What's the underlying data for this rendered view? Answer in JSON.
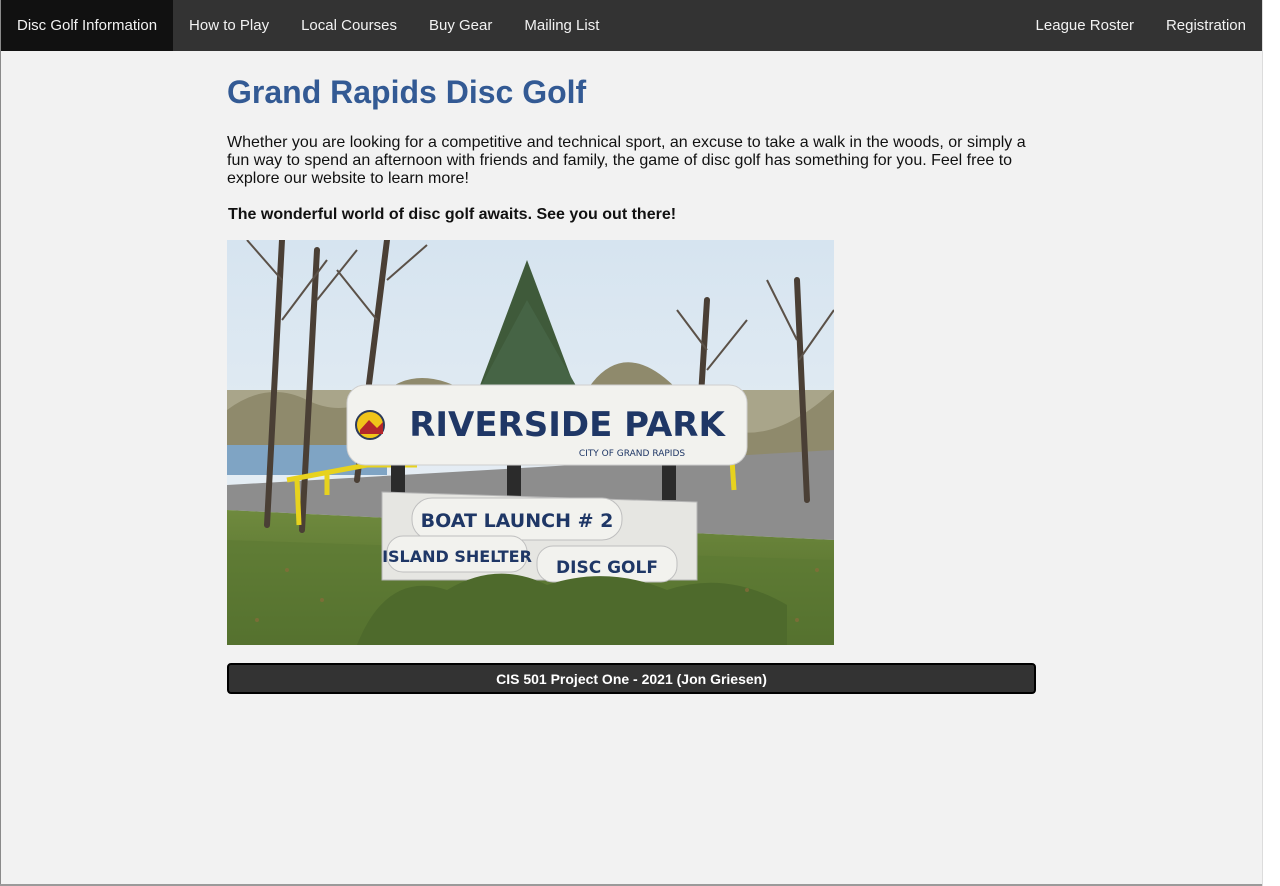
{
  "nav": {
    "left": [
      {
        "label": "Disc Golf Information",
        "active": true
      },
      {
        "label": "How to Play",
        "active": false
      },
      {
        "label": "Local Courses",
        "active": false
      },
      {
        "label": "Buy Gear",
        "active": false
      },
      {
        "label": "Mailing List",
        "active": false
      }
    ],
    "right": [
      {
        "label": "League Roster"
      },
      {
        "label": "Registration"
      }
    ]
  },
  "main": {
    "title": "Grand Rapids Disc Golf",
    "intro": "Whether you are looking for a competitive and technical sport, an excuse to take a walk in the woods, or simply a fun way to spend an afternoon with friends and family, the game of disc golf has something for you. Feel free to explore our website to learn more!",
    "tagline": "The wonderful world of disc golf awaits. See you out there!",
    "photo": {
      "sign_title": "RIVERSIDE PARK",
      "sign_subtitle": "CITY OF GRAND RAPIDS",
      "sign_line1": "BOAT LAUNCH # 2",
      "sign_line2a": "ISLAND SHELTER",
      "sign_line2b": "DISC GOLF"
    }
  },
  "footer": {
    "text": "CIS 501 Project One - 2021 (Jon Griesen)"
  },
  "colors": {
    "nav_bg": "#333333",
    "nav_active": "#111111",
    "title": "#335a94",
    "page_bg": "#f2f2f2"
  }
}
